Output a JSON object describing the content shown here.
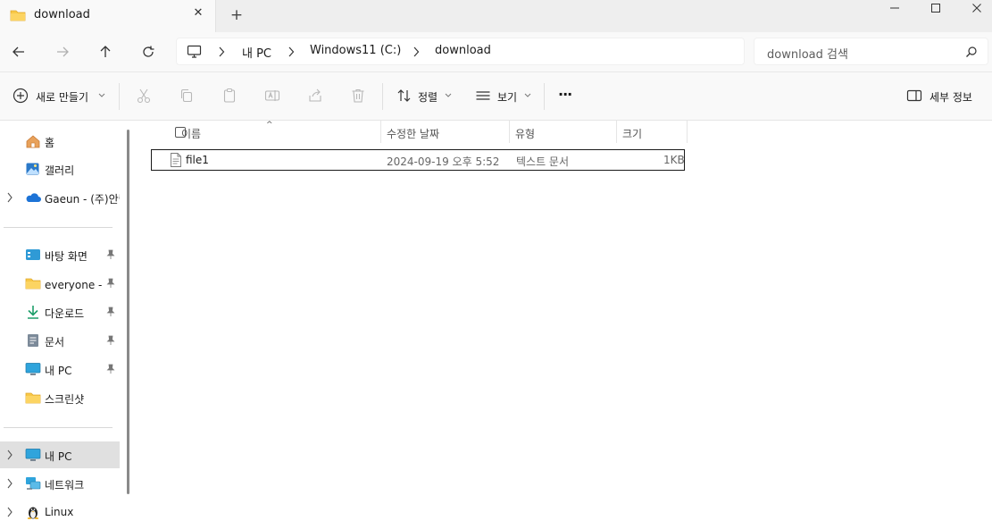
{
  "tab": {
    "title": "download",
    "close": "✕",
    "new": "+"
  },
  "address": {
    "crumbs": [
      "내 PC",
      "Windows11 (C:)",
      "download"
    ],
    "search_placeholder": "download 검색"
  },
  "toolbar": {
    "new_label": "새로 만들기",
    "sort_label": "정렬",
    "view_label": "보기",
    "more_label": "···",
    "details_label": "세부 정보"
  },
  "nav": {
    "quick": [
      {
        "label": "홈",
        "icon": "home-icon"
      },
      {
        "label": "갤러리",
        "icon": "gallery-icon"
      },
      {
        "label": "Gaeun - (주)안랩",
        "icon": "onedrive-icon"
      }
    ],
    "pinned": [
      {
        "label": "바탕 화면",
        "icon": "desktop-icon"
      },
      {
        "label": "everyone - 문서",
        "icon": "folder-icon"
      },
      {
        "label": "다운로드",
        "icon": "download-icon"
      },
      {
        "label": "문서",
        "icon": "document-icon"
      },
      {
        "label": "내 PC",
        "icon": "pc-icon"
      },
      {
        "label": "스크린샷",
        "icon": "folder-icon"
      }
    ],
    "drives": [
      {
        "label": "내 PC",
        "icon": "pc-icon"
      },
      {
        "label": "네트워크",
        "icon": "network-icon"
      },
      {
        "label": "Linux",
        "icon": "linux-icon"
      }
    ]
  },
  "columns": {
    "name": "이름",
    "modified": "수정한 날짜",
    "type": "유형",
    "size": "크기",
    "sort_indicator": "^"
  },
  "files": [
    {
      "name": "file1",
      "modified": "2024-09-19 오후 5:52",
      "type": "텍스트 문서",
      "size": "1KB"
    }
  ],
  "colors": {
    "accent": "#0067c0",
    "folder": "#f8c847",
    "selection": "#e0e0e0"
  }
}
